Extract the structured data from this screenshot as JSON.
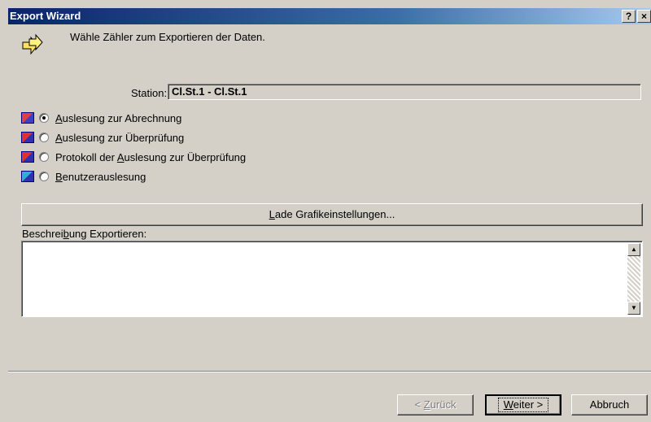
{
  "window": {
    "title": "Export Wizard",
    "help_label": "?",
    "close_label": "×"
  },
  "header": {
    "text": "Wähle Zähler zum Exportieren der Daten."
  },
  "station": {
    "label": "Station:",
    "value": "Cl.St.1 - Cl.St.1"
  },
  "options": [
    {
      "label_pre": "",
      "label_u": "A",
      "label_post": "uslesung zur Abrechnung",
      "checked": true,
      "icon_color": "#c03030"
    },
    {
      "label_pre": "",
      "label_u": "A",
      "label_post": "uslesung zur Überprüfung",
      "checked": false,
      "icon_color": "#c02020"
    },
    {
      "label_pre": "Protokoll der ",
      "label_u": "A",
      "label_post": "uslesung zur Überprüfung",
      "checked": false,
      "icon_color": "#c02020"
    },
    {
      "label_pre": "",
      "label_u": "B",
      "label_post": "enutzerauslesung",
      "checked": false,
      "icon_color": "#20a0c0"
    }
  ],
  "load_button": {
    "u": "L",
    "rest": "ade Grafikeinstellungen..."
  },
  "description": {
    "label_pre": "Beschrei",
    "label_u": "b",
    "label_post": "ung Exportieren:",
    "value": ""
  },
  "buttons": {
    "back_pre": "< ",
    "back_u": "Z",
    "back_post": "urück",
    "next_u": "W",
    "next_post": "eiter >",
    "cancel": "Abbruch"
  }
}
